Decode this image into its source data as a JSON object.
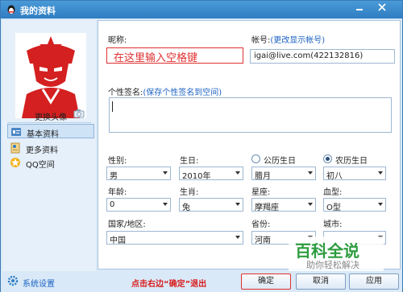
{
  "window": {
    "title": "我的资料",
    "icon": "qq-penguin-icon"
  },
  "sidebar": {
    "change_avatar": "更换头像",
    "items": [
      {
        "label": "基本资料",
        "icon": "card-icon",
        "active": true
      },
      {
        "label": "更多资料",
        "icon": "profile-icon",
        "active": false
      },
      {
        "label": "QQ空间",
        "icon": "qzone-icon",
        "active": false
      }
    ],
    "system_settings": "系统设置"
  },
  "form": {
    "nickname_label": "昵称:",
    "nickname_value": "在这里输入空格键",
    "account_label": "帐号:",
    "account_link": "(更改显示帐号)",
    "account_value": "igai@live.com(422132816)",
    "signature_label": "个性签名:",
    "signature_link": "(保存个性签名到空间)",
    "gender_label": "性别:",
    "gender_value": "男",
    "birthday_label": "生日:",
    "solar_label": "公历生日",
    "lunar_label": "农历生日",
    "year_value": "2010年",
    "month_value": "腊月",
    "day_value": "初八",
    "age_label": "年龄:",
    "age_value": "0",
    "zodiac_label": "生肖:",
    "zodiac_value": "兔",
    "constellation_label": "星座:",
    "constellation_value": "摩羯座",
    "blood_label": "血型:",
    "blood_value": "O型",
    "country_label": "国家/地区:",
    "country_value": "中国",
    "province_label": "省份:",
    "province_value": "河南",
    "city_label": "城市:"
  },
  "watermark": {
    "big": "百科全说",
    "small": "助你轻松解决"
  },
  "footer": {
    "hint": "点击右边“确定”退出",
    "ok": "确定",
    "cancel": "取消",
    "apply": "应用"
  },
  "colors": {
    "accent": "#1c63c2",
    "hint_red": "#d81e1e",
    "titlebar": "#2f7dc2",
    "watermark_green": "#2d9c3f"
  }
}
